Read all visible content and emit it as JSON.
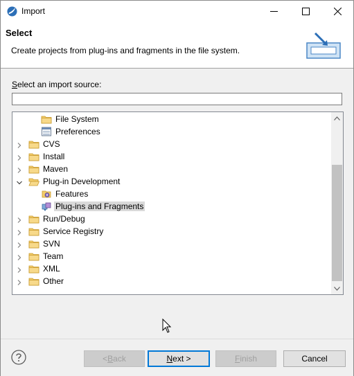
{
  "window": {
    "title": "Import",
    "minimize_icon": "minimize-icon",
    "maximize_icon": "maximize-icon",
    "close_icon": "close-icon"
  },
  "header": {
    "title": "Select",
    "description": "Create projects from plug-ins and fragments in the file system."
  },
  "source": {
    "label": "Select an import source:",
    "filter_value": "",
    "filter_placeholder": ""
  },
  "tree": {
    "items": [
      {
        "label": "File System",
        "level": 1,
        "icon": "folder-icon",
        "expandable": false
      },
      {
        "label": "Preferences",
        "level": 1,
        "icon": "preferences-icon",
        "expandable": false
      },
      {
        "label": "CVS",
        "level": 0,
        "icon": "folder-icon",
        "expandable": true,
        "expanded": false
      },
      {
        "label": "Install",
        "level": 0,
        "icon": "folder-icon",
        "expandable": true,
        "expanded": false
      },
      {
        "label": "Maven",
        "level": 0,
        "icon": "folder-icon",
        "expandable": true,
        "expanded": false
      },
      {
        "label": "Plug-in Development",
        "level": 0,
        "icon": "folder-open-icon",
        "expandable": true,
        "expanded": true
      },
      {
        "label": "Features",
        "level": 1,
        "icon": "features-icon",
        "expandable": false
      },
      {
        "label": "Plug-ins and Fragments",
        "level": 1,
        "icon": "plugins-icon",
        "expandable": false,
        "selected": true
      },
      {
        "label": "Run/Debug",
        "level": 0,
        "icon": "folder-icon",
        "expandable": true,
        "expanded": false
      },
      {
        "label": "Service Registry",
        "level": 0,
        "icon": "folder-icon",
        "expandable": true,
        "expanded": false
      },
      {
        "label": "SVN",
        "level": 0,
        "icon": "folder-icon",
        "expandable": true,
        "expanded": false
      },
      {
        "label": "Team",
        "level": 0,
        "icon": "folder-icon",
        "expandable": true,
        "expanded": false
      },
      {
        "label": "XML",
        "level": 0,
        "icon": "folder-icon",
        "expandable": true,
        "expanded": false
      },
      {
        "label": "Other",
        "level": 0,
        "icon": "folder-icon",
        "expandable": true,
        "expanded": false
      }
    ]
  },
  "footer": {
    "help_icon": "help-icon",
    "back_label": "< Back",
    "next_label": "Next >",
    "finish_label": "Finish",
    "cancel_label": "Cancel"
  },
  "colors": {
    "accent": "#0078d7",
    "folder": "#e8b84a",
    "selection": "#d9d9d9"
  }
}
